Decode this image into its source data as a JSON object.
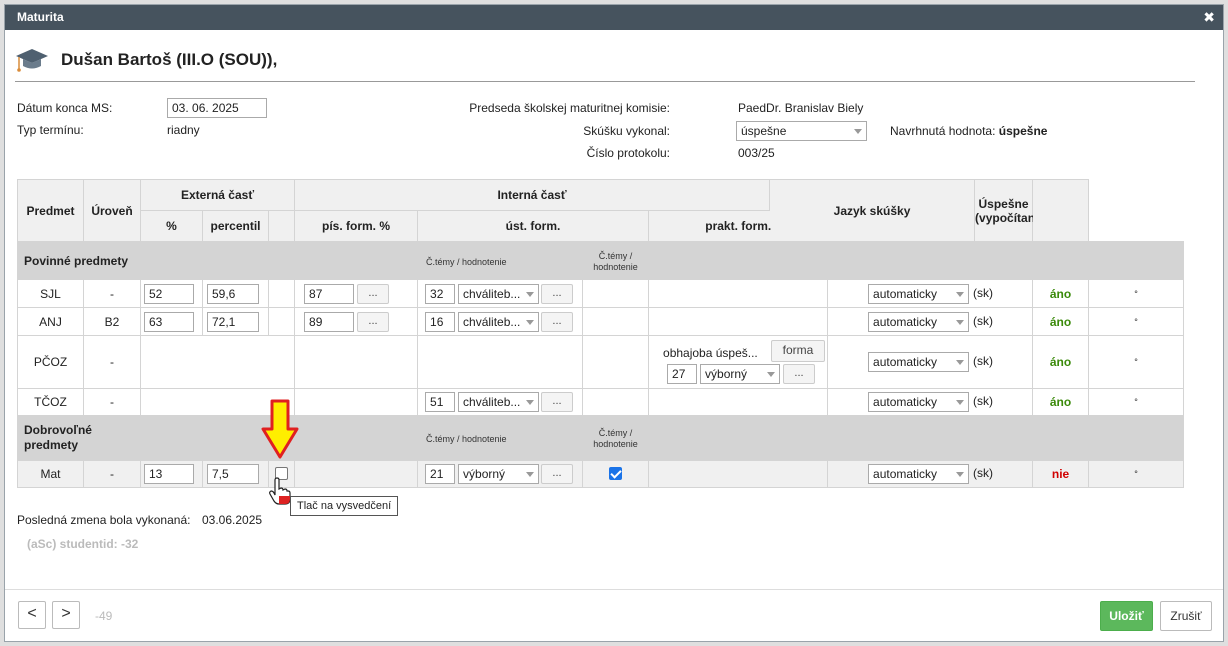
{
  "dialog": {
    "title": "Maturita",
    "close": "✖"
  },
  "student": {
    "name": "Dušan Bartoš (III.O (SOU)),"
  },
  "form": {
    "end_date_label": "Dátum konca MS:",
    "end_date_value": "03. 06. 2025",
    "term_type_label": "Typ termínu:",
    "term_type_value": "riadny",
    "chair_label": "Predseda školskej maturitnej komisie:",
    "chair_value": "PaedDr. Branislav Biely",
    "exam_done_label": "Skúšku vykonal:",
    "exam_done_value": "úspešne",
    "suggested_label": "Navrhnutá hodnota:",
    "suggested_value": "úspešne",
    "protocol_label": "Číslo protokolu:",
    "protocol_value": "003/25"
  },
  "table": {
    "headers": {
      "subject": "Predmet",
      "level": "Úroveň",
      "external": "Externá časť",
      "internal": "Interná časť",
      "percent": "%",
      "percentil": "percentil",
      "written": "pís. form. %",
      "oral": "úst. form.",
      "practical": "prakt. form.",
      "language": "Jazyk skúšky",
      "success_line1": "Úspešne",
      "success_line2": "(vypočítané)"
    },
    "hint_topics": "Č.témy / hodnotenie",
    "hint_topics_l1": "Č.témy /",
    "hint_topics_l2": "hodnotenie",
    "mandatory_section": "Povinné predmety",
    "optional_section_l1": "Dobrovoľné",
    "optional_section_l2": "predmety",
    "dots": "...",
    "lang_suffix": "(sk)",
    "degree": "°",
    "rows": [
      {
        "subject": "SJL",
        "level": "-",
        "percent": "52",
        "percentil": "59,6",
        "written": "87",
        "oral_topic": "32",
        "oral_grade": "chváliteb...",
        "language": "automaticky",
        "success": "áno"
      },
      {
        "subject": "ANJ",
        "level": "B2",
        "percent": "63",
        "percentil": "72,1",
        "written": "89",
        "oral_topic": "16",
        "oral_grade": "chváliteb...",
        "language": "automaticky",
        "success": "áno"
      },
      {
        "subject": "PČOZ",
        "level": "-",
        "practical_text": "obhajoba úspeš...",
        "practical_btn": "forma",
        "practical_topic": "27",
        "practical_grade": "výborný",
        "language": "automaticky",
        "success": "áno"
      },
      {
        "subject": "TČOZ",
        "level": "-",
        "oral_topic": "51",
        "oral_grade": "chváliteb...",
        "language": "automaticky",
        "success": "áno"
      },
      {
        "subject": "Mat",
        "level": "-",
        "percent": "13",
        "percentil": "7,5",
        "oral_topic": "21",
        "oral_grade": "výborný",
        "language": "automaticky",
        "success": "nie"
      }
    ]
  },
  "tooltip": "Tlač na vysvedčení",
  "last_change_label": "Posledná zmena bola vykonaná:",
  "last_change_value": "03.06.2025",
  "student_id": "(aSc) studentid: -32",
  "footer": {
    "prev": "<",
    "next": ">",
    "counter": "-49",
    "save": "Uložiť",
    "cancel": "Zrušiť"
  },
  "colors": {
    "titlebar": "#46535e",
    "success": "#3a8a0a",
    "fail": "#d00000",
    "save": "#5cb85c",
    "arrow": "#ffee00"
  }
}
